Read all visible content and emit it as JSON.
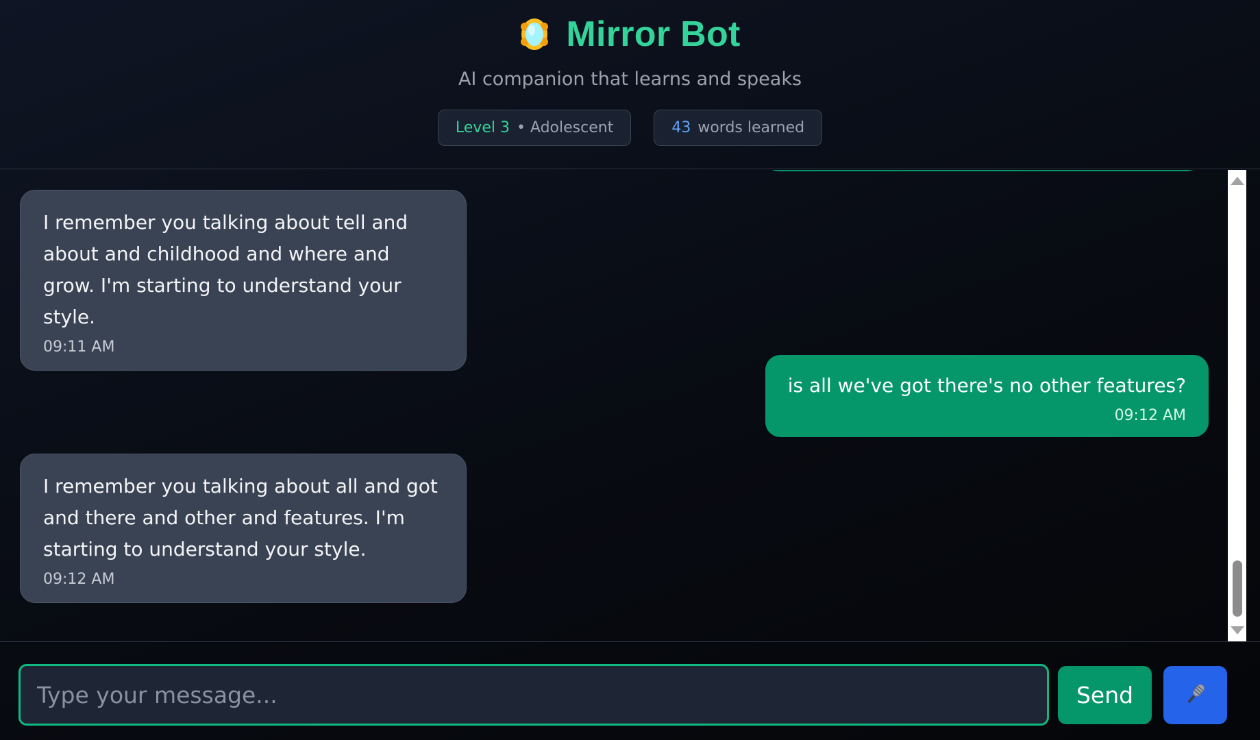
{
  "header": {
    "icon": "mirror-icon",
    "title": "Mirror Bot",
    "subtitle": "AI companion that learns and speaks",
    "level_label": "Level 3",
    "stage_label": "• Adolescent",
    "words_count": "43",
    "words_label": "words learned"
  },
  "messages": [
    {
      "role": "bot",
      "text": "I remember you talking about tell and about and childhood and where and grow. I'm starting to understand your style.",
      "time": "09:11 AM"
    },
    {
      "role": "user",
      "text": "is all we've got there's no other features?",
      "time": "09:12 AM"
    },
    {
      "role": "bot",
      "text": "I remember you talking about all and got and there and other and features. I'm starting to understand your style.",
      "time": "09:12 AM"
    }
  ],
  "composer": {
    "placeholder": "Type your message...",
    "value": "",
    "send_label": "Send",
    "mic_icon": "microphone-icon"
  },
  "colors": {
    "accent": "#34d399",
    "user_bubble": "#059669",
    "bot_bubble": "#3a4354",
    "mic_button": "#2563eb",
    "count": "#60a5fa"
  }
}
